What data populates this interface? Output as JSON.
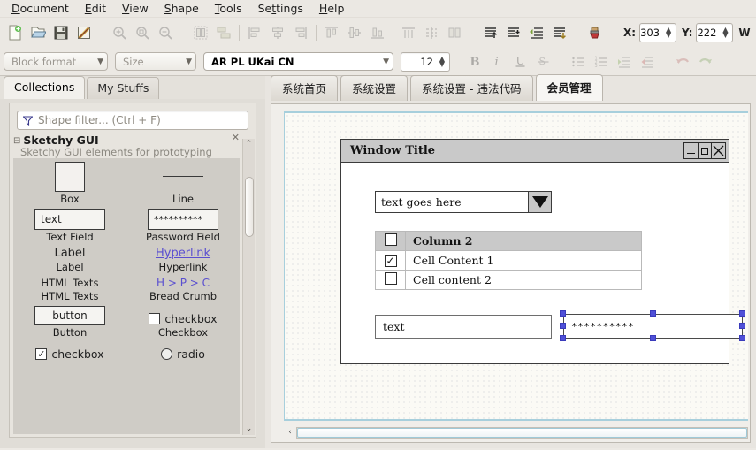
{
  "app": {
    "menubar": [
      {
        "label": "Document",
        "accel": "D",
        "name": "menu-document"
      },
      {
        "label": "Edit",
        "accel": "E",
        "name": "menu-edit"
      },
      {
        "label": "View",
        "accel": "V",
        "name": "menu-view"
      },
      {
        "label": "Shape",
        "accel": "S",
        "name": "menu-shape"
      },
      {
        "label": "Tools",
        "accel": "T",
        "name": "menu-tools"
      },
      {
        "label": "Settings",
        "accel": "S",
        "name": "menu-settings"
      },
      {
        "label": "Help",
        "accel": "H",
        "name": "menu-help"
      }
    ]
  },
  "toolbar": {
    "icons_row1": [
      "new-document-icon",
      "open-document-icon",
      "save-document-icon",
      "export-icon",
      "zoom-in-icon",
      "zoom-reset-icon",
      "zoom-out-icon",
      "group-icon",
      "ungroup-icon",
      "align-left-icon",
      "align-center-icon",
      "align-right-icon",
      "align-top-icon",
      "align-middle-icon",
      "align-bottom-icon",
      "bring-to-front-icon",
      "bring-forward-icon",
      "send-backward-icon",
      "send-to-back-icon",
      "paint-brush-icon"
    ],
    "x_label": "X:",
    "x_value": "303",
    "y_label": "Y:",
    "y_value": "222",
    "w_label": "W",
    "block_format": "Block format",
    "size_select": "Size",
    "font_name": "AR PL UKai CN",
    "font_size": "12",
    "icons_row2": [
      "bold-icon",
      "italic-icon",
      "underline-icon",
      "strikethrough-icon",
      "bullet-list-icon",
      "numbered-list-icon",
      "indent-increase-icon",
      "indent-decrease-icon",
      "undo-icon",
      "redo-icon"
    ]
  },
  "left_panel": {
    "tabs": [
      {
        "label": "Collections",
        "active": true
      },
      {
        "label": "My Stuffs",
        "active": false
      }
    ],
    "filter_placeholder": "Shape filter... (Ctrl + F)",
    "collection": {
      "title": "Sketchy GUI",
      "subtitle": "Sketchy GUI elements for prototyping"
    },
    "shapes": [
      {
        "caption": "Box",
        "kind": "box"
      },
      {
        "caption": "Line",
        "kind": "line"
      },
      {
        "caption": "Text Field",
        "kind": "textfield",
        "sample": "text"
      },
      {
        "caption": "Password Field",
        "kind": "passwordfield",
        "sample": "**********"
      },
      {
        "caption": "Label",
        "kind": "label",
        "sample": "Label"
      },
      {
        "caption": "Hyperlink",
        "kind": "hyperlink",
        "sample": "Hyperlink"
      },
      {
        "caption": "HTML Texts",
        "kind": "htmltexts",
        "sample": "HTML Texts"
      },
      {
        "caption": "Bread Crumb",
        "kind": "breadcrumb",
        "sample": "H > P > C"
      },
      {
        "caption": "Button",
        "kind": "button",
        "sample": "button"
      },
      {
        "caption": "Checkbox",
        "kind": "checkbox",
        "sample": "checkbox"
      },
      {
        "caption": "",
        "kind": "checkbox-checked",
        "sample": "checkbox"
      },
      {
        "caption": "",
        "kind": "radio",
        "sample": "radio"
      }
    ]
  },
  "canvas_tabs": [
    {
      "label": "系统首页",
      "active": false
    },
    {
      "label": "系统设置",
      "active": false
    },
    {
      "label": "系统设置 - 违法代码",
      "active": false
    },
    {
      "label": "会员管理",
      "active": true
    }
  ],
  "mockup": {
    "window_title": "Window Title",
    "window_buttons": [
      "minimize",
      "maximize",
      "close"
    ],
    "combo_value": "text goes here",
    "table": {
      "headers": [
        "",
        "Column 2"
      ],
      "rows": [
        {
          "checked": true,
          "cell": "Cell Content 1"
        },
        {
          "checked": false,
          "cell": "Cell content 2"
        }
      ],
      "header_checked": false
    },
    "text_field_value": "text",
    "password_field_value": "**********",
    "selection": {
      "selected_element": "password-field",
      "handle_count": 8
    }
  },
  "colors": {
    "selection_handle": "#4f50d8",
    "canvas_border": "#a7cfdc",
    "hyperlink": "#5a4fd0",
    "toolbar_bg": "#ebe8e3"
  }
}
